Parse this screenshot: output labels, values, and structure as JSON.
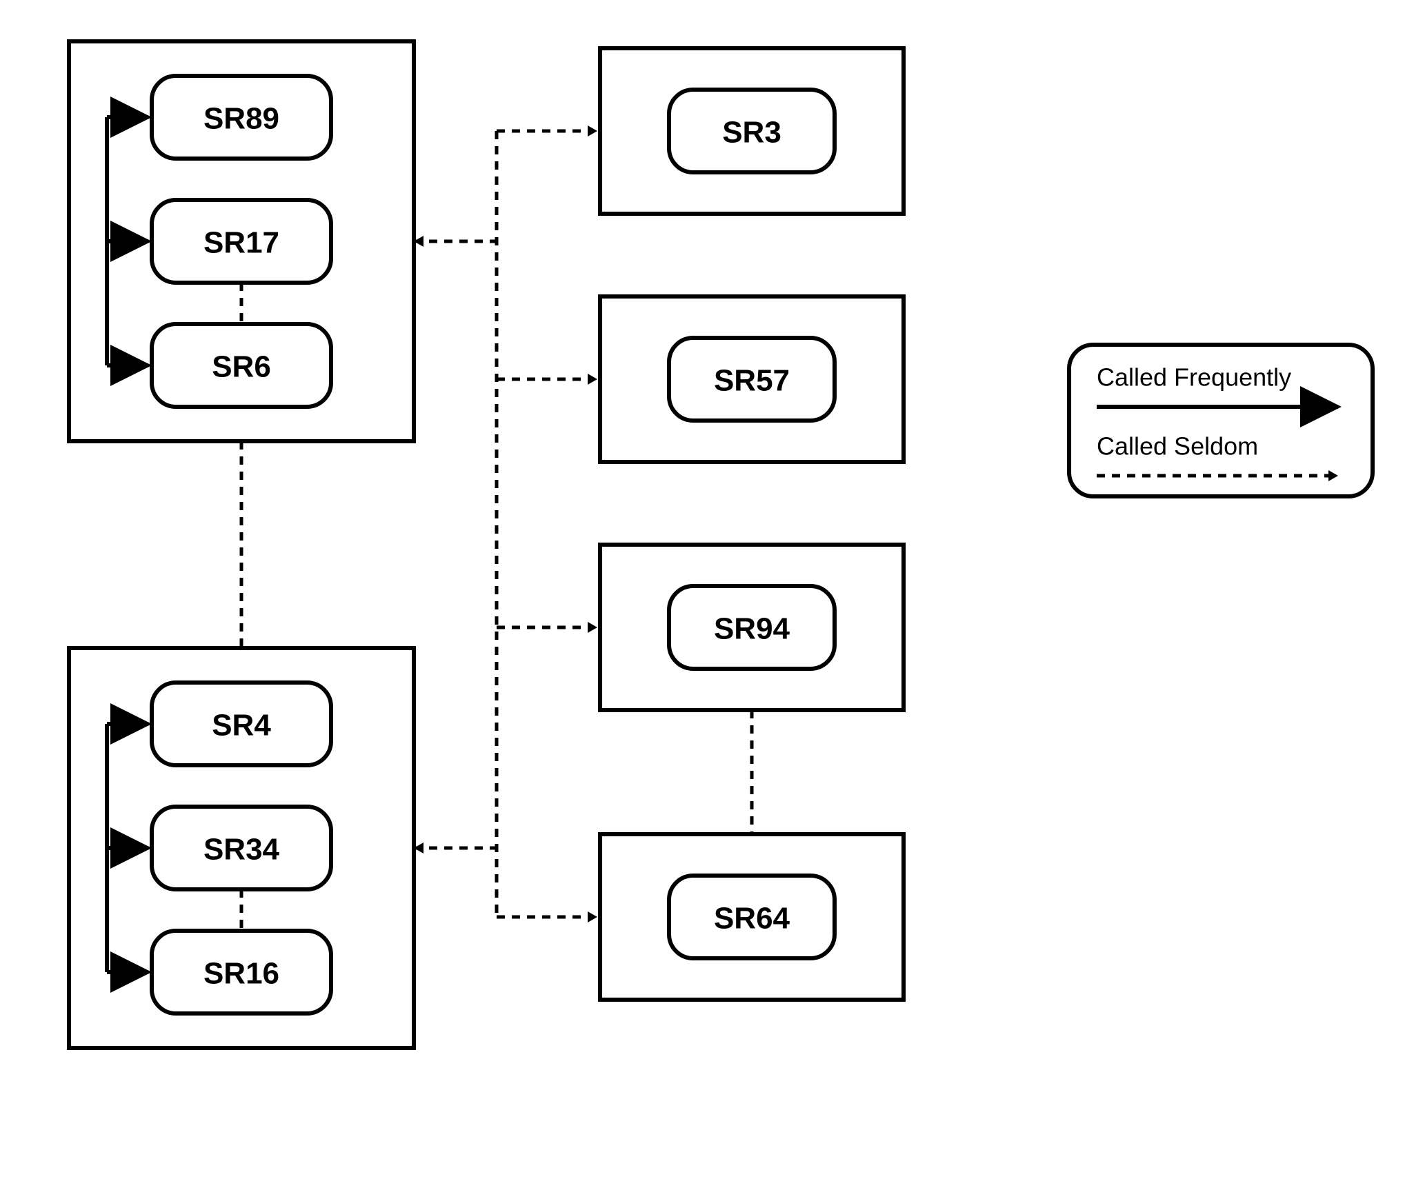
{
  "groups": {
    "top_left": {
      "nodes": [
        "SR89",
        "SR17",
        "SR6"
      ]
    },
    "bottom_left": {
      "nodes": [
        "SR4",
        "SR34",
        "SR16"
      ]
    }
  },
  "right_boxes": [
    "SR3",
    "SR57",
    "SR94",
    "SR64"
  ],
  "legend": {
    "frequent": "Called Frequently",
    "seldom": "Called Seldom"
  }
}
